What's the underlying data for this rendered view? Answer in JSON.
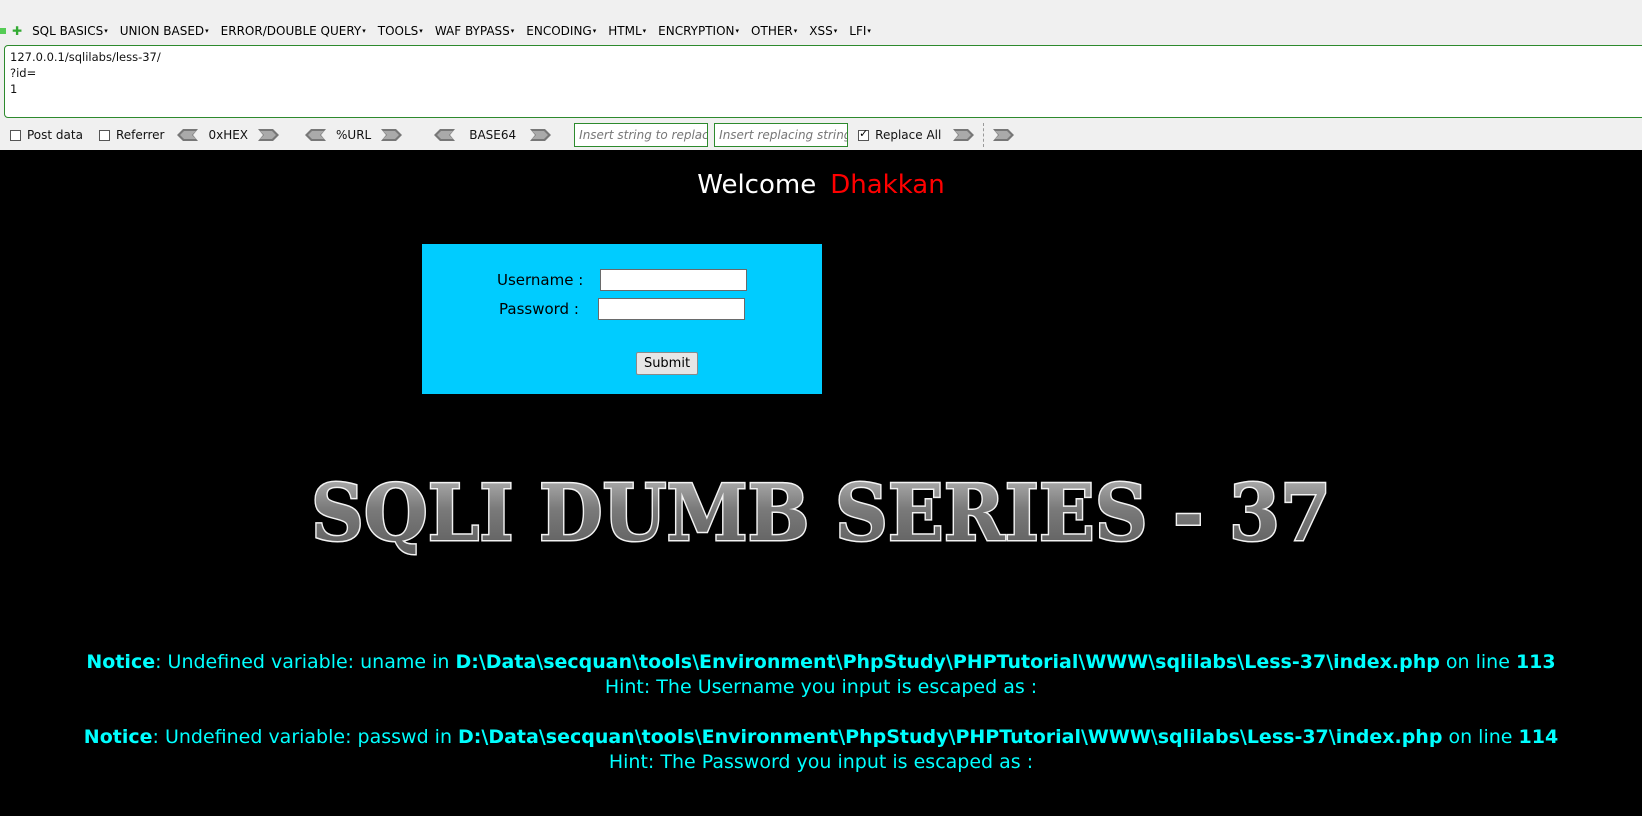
{
  "toolbar": {
    "menu": [
      "SQL BASICS",
      "UNION BASED",
      "ERROR/DOUBLE QUERY",
      "TOOLS",
      "WAF BYPASS",
      "ENCODING",
      "HTML",
      "ENCRYPTION",
      "OTHER",
      "XSS",
      "LFI"
    ],
    "url_lines": [
      "127.0.0.1/sqlilabs/less-37/",
      "?id=",
      "1"
    ],
    "post_data_label": "Post data",
    "referrer_label": "Referrer",
    "hex_label": "0xHEX",
    "url_label": "%URL",
    "base64_label": "BASE64",
    "replace_placeholder": "Insert string to replace",
    "replacing_placeholder": "Insert replacing string",
    "replace_all_label": "Replace All",
    "replace_all_checked": true,
    "accent_color": "#2d8a2d"
  },
  "page": {
    "welcome": "Welcome",
    "user": "Dhakkan",
    "username_label": "Username :",
    "password_label": "Password :",
    "submit_label": "Submit",
    "banner": "SQLI DUMB SERIES - 37",
    "notices": [
      {
        "tag": "Notice",
        "msg": ": Undefined variable: uname in ",
        "path": "D:\\Data\\secquan\\tools\\Environment\\PhpStudy\\PHPTutorial\\WWW\\sqlilabs\\Less-37\\index.php",
        "on_line": " on line ",
        "line": "113",
        "hint": "Hint: The Username you input is escaped as :"
      },
      {
        "tag": "Notice",
        "msg": ": Undefined variable: passwd in ",
        "path": "D:\\Data\\secquan\\tools\\Environment\\PhpStudy\\PHPTutorial\\WWW\\sqlilabs\\Less-37\\index.php",
        "on_line": " on line ",
        "line": "114",
        "hint": "Hint: The Password you input is escaped as :"
      }
    ],
    "colors": {
      "login_bg": "#00ccff",
      "notice": "#00ffff",
      "user": "#ff0000"
    }
  }
}
